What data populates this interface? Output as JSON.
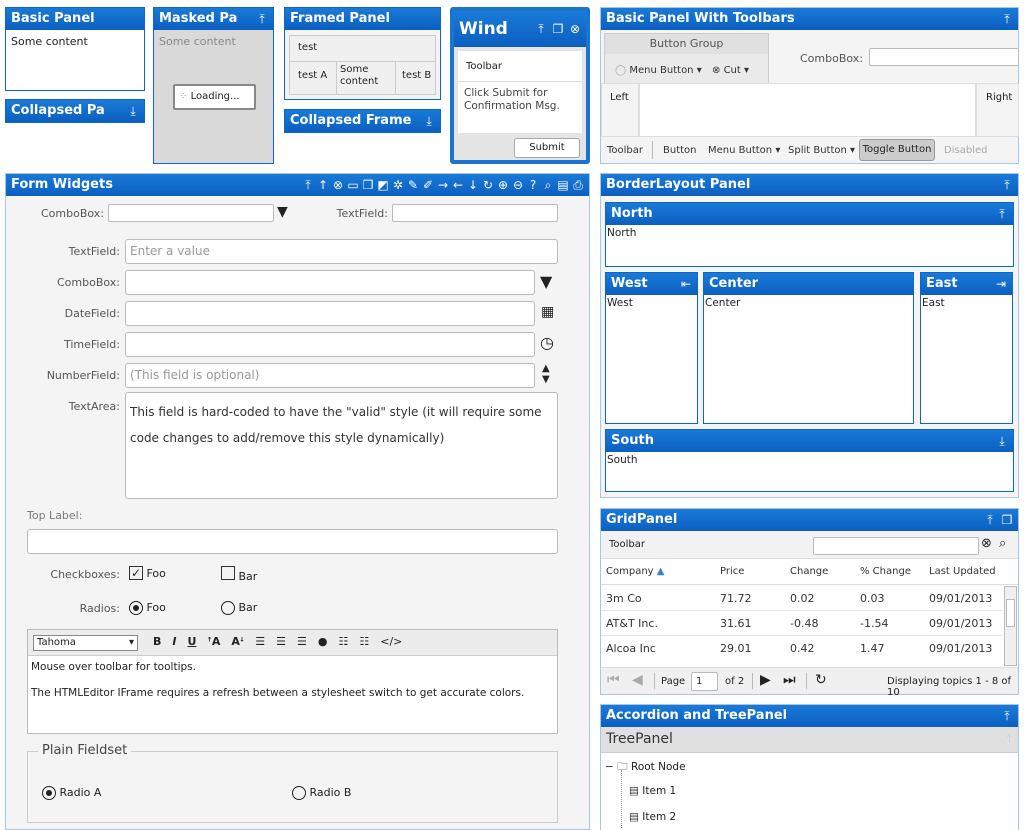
{
  "basic_panel": {
    "title": "Basic Panel",
    "content": "Some content"
  },
  "collapsed_panel": {
    "title": "Collapsed Pa"
  },
  "masked_panel": {
    "title": "Masked Pa",
    "content": "Some content",
    "loading": "Loading..."
  },
  "framed_panel": {
    "title": "Framed Panel",
    "cells": [
      "test",
      "test A",
      "Some content",
      "test B"
    ]
  },
  "collapsed_frame": {
    "title": "Collapsed Frame"
  },
  "window": {
    "title": "Wind",
    "toolbar": "Toolbar",
    "message": "Click Submit for Confirmation Msg.",
    "submit": "Submit"
  },
  "toolbars_panel": {
    "title": "Basic Panel With Toolbars",
    "button_group": "Button Group",
    "menu_button": "Menu Button",
    "cut": "Cut",
    "combobox_label": "ComboBox:",
    "left": "Left",
    "right": "Right",
    "bottom": [
      "Toolbar",
      "Button",
      "Menu Button",
      "Split Button",
      "Toggle Button",
      "Disabled"
    ]
  },
  "form_widgets": {
    "title": "Form Widgets",
    "combobox_label": "ComboBox:",
    "textfield_label": "TextField:",
    "rows": [
      {
        "label": "TextField:",
        "placeholder": "Enter a value"
      },
      {
        "label": "ComboBox:",
        "placeholder": ""
      },
      {
        "label": "DateField:",
        "placeholder": ""
      },
      {
        "label": "TimeField:",
        "placeholder": ""
      },
      {
        "label": "NumberField:",
        "placeholder": "(This field is optional)"
      }
    ],
    "textarea_label": "TextArea:",
    "textarea_value": "This field is hard-coded to have the \"valid\" style (it will require some code changes to add/remove this style dynamically)",
    "top_label": "Top Label:",
    "checkboxes_label": "Checkboxes:",
    "checkboxes": [
      {
        "label": "Foo",
        "checked": true
      },
      {
        "label": "Bar",
        "checked": false
      }
    ],
    "radios_label": "Radios:",
    "radios": [
      {
        "label": "Foo",
        "checked": true
      },
      {
        "label": "Bar",
        "checked": false
      }
    ],
    "editor_font": "Tahoma",
    "editor_lines": [
      "Mouse over toolbar for tooltips.",
      "The HTMLEditor IFrame requires a refresh between a stylesheet switch to get accurate colors."
    ],
    "fieldset_title": "Plain Fieldset",
    "fieldset_radios": [
      {
        "label": "Radio A",
        "checked": true
      },
      {
        "label": "Radio B",
        "checked": false
      }
    ]
  },
  "border_layout": {
    "title": "BorderLayout Panel",
    "north": {
      "title": "North",
      "content": "North"
    },
    "west": {
      "title": "West",
      "content": "West"
    },
    "center": {
      "title": "Center",
      "content": "Center"
    },
    "east": {
      "title": "East",
      "content": "East"
    },
    "south": {
      "title": "South",
      "content": "South"
    }
  },
  "grid": {
    "title": "GridPanel",
    "toolbar": "Toolbar",
    "columns": [
      "Company",
      "Price",
      "Change",
      "% Change",
      "Last Updated"
    ],
    "rows": [
      [
        "3m Co",
        "71.72",
        "0.02",
        "0.03",
        "09/01/2013"
      ],
      [
        "AT&T Inc.",
        "31.61",
        "-0.48",
        "-1.54",
        "09/01/2013"
      ],
      [
        "Alcoa Inc",
        "29.01",
        "0.42",
        "1.47",
        "09/01/2013"
      ]
    ],
    "page_label": "Page",
    "page_value": "1",
    "page_of": "of 2",
    "display": "Displaying topics 1 - 8 of 10"
  },
  "accordion": {
    "title": "Accordion and TreePanel",
    "tree_title": "TreePanel",
    "root": "Root Node",
    "items": [
      "Item 1",
      "Item 2"
    ]
  },
  "colors": {
    "header": "#0b68c9",
    "panel_border": "#a6c6ec"
  }
}
